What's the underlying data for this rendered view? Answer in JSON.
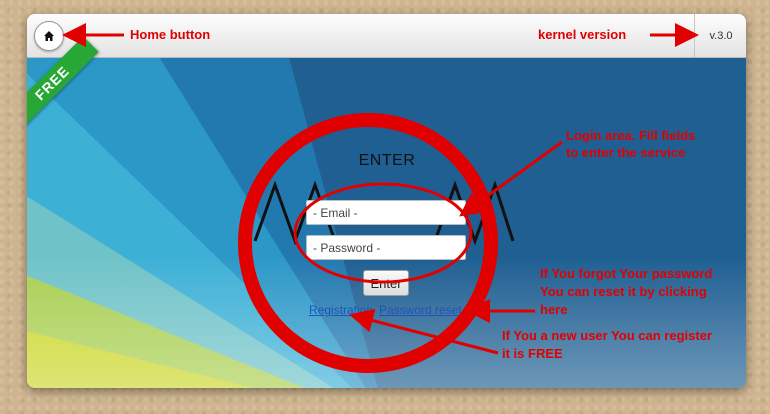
{
  "topbar": {
    "version": "v.3.0"
  },
  "ribbon": {
    "label": "FREE"
  },
  "login": {
    "title": "ENTER",
    "email_placeholder": "- Email -",
    "password_placeholder": "- Password -",
    "enter_label": "Enter"
  },
  "links": {
    "registration": "Registration",
    "password_reset": "Password reset"
  },
  "annotations": {
    "home_button": "Home button",
    "kernel_version": "kernel version",
    "login_area_1": "Login area. Fill fields",
    "login_area_2": "to enter the service",
    "forgot_1": "If You forgot Your password",
    "forgot_2": "You can reset it by clicking",
    "forgot_3": "here",
    "new_user_1": "If You a new user You can register",
    "new_user_2": "it is FREE"
  },
  "colors": {
    "annotation": "#e10000",
    "ribbon": "#27a836",
    "link": "#1b55b8"
  },
  "icons": {
    "home": "home-icon"
  }
}
